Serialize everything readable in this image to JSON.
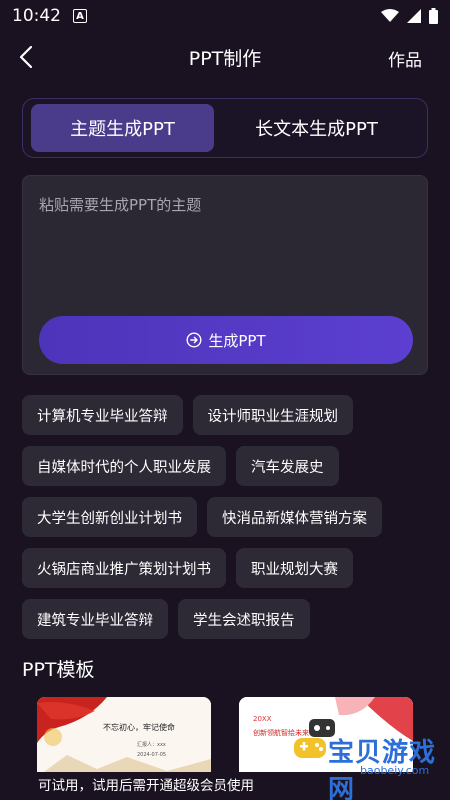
{
  "status": {
    "time": "10:42",
    "notif_letter": "A"
  },
  "nav": {
    "title": "PPT制作",
    "works": "作品"
  },
  "tabs": [
    {
      "label": "主题生成PPT",
      "active": true
    },
    {
      "label": "长文本生成PPT",
      "active": false
    }
  ],
  "input": {
    "placeholder": "粘贴需要生成PPT的主题",
    "value": ""
  },
  "generate_button": {
    "label": "生成PPT"
  },
  "chips": [
    [
      "计算机专业毕业答辩",
      "设计师职业生涯规划"
    ],
    [
      "自媒体时代的个人职业发展",
      "汽车发展史"
    ],
    [
      "大学生创新创业计划书",
      "快消品新媒体营销方案"
    ],
    [
      "火锅店商业推广策划计划书",
      "职业规划大赛"
    ],
    [
      "建筑专业毕业答辩",
      "学生会述职报告"
    ]
  ],
  "templates": {
    "section_title": "PPT模板",
    "items": [
      {
        "headline": "不忘初心，牢记使命",
        "line1": "汇报人：xxx",
        "line2": "2024-07-05"
      },
      {
        "year_tag": "20XX",
        "headline": "创新领航智绘未来"
      }
    ]
  },
  "notice": "可试用，试用后需开通超级会员使用",
  "watermark": {
    "text": "宝贝游戏网",
    "domain": "baobeiy.com"
  },
  "colors": {
    "background": "#1a1221",
    "accent": "#4a3c8a",
    "chip": "#2d2a35",
    "button": "#5c3fd0"
  }
}
